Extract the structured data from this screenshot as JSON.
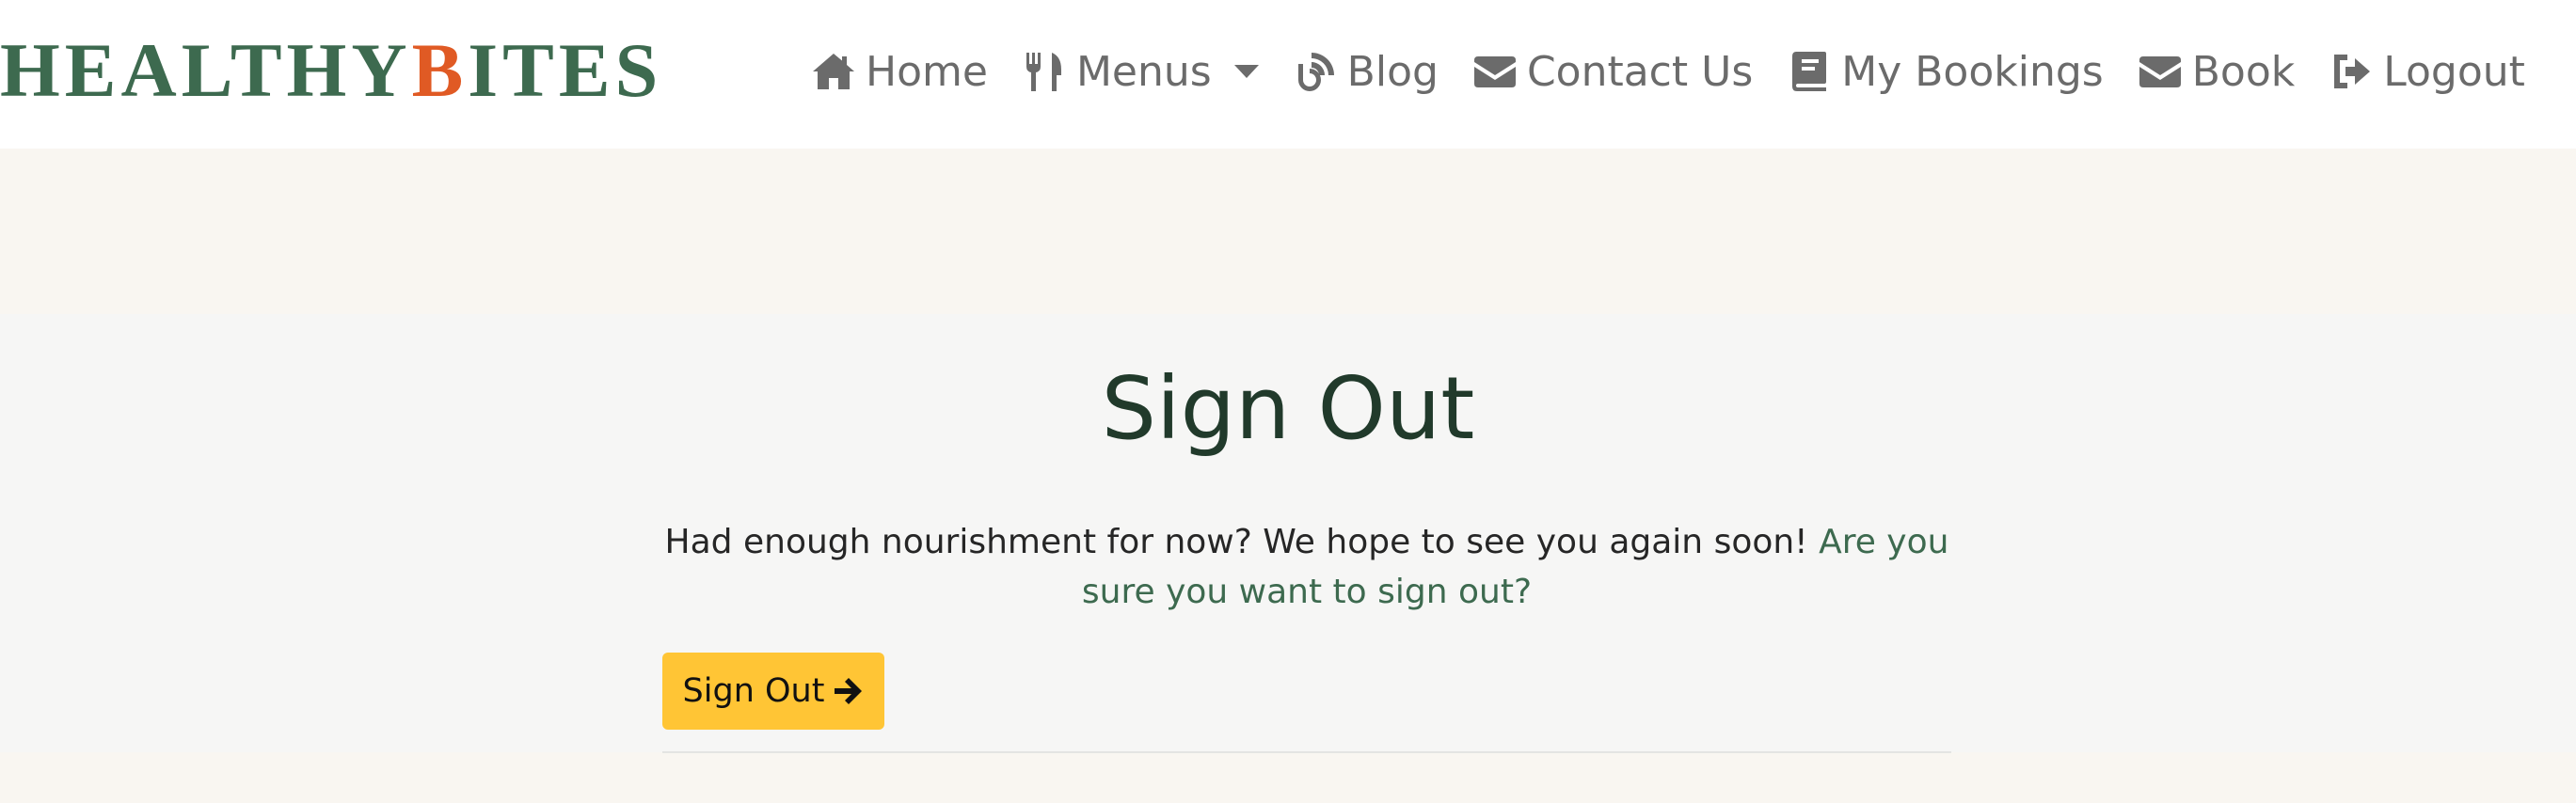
{
  "brand": {
    "part1": "HEALTHY",
    "part2": "B",
    "part3": "ITES",
    "color_primary": "#3d6a4f",
    "color_accent": "#e05a24"
  },
  "nav": {
    "home": {
      "label": "Home",
      "icon": "home-icon"
    },
    "menus": {
      "label": "Menus",
      "icon": "utensils-icon"
    },
    "blog": {
      "label": "Blog",
      "icon": "blog-icon"
    },
    "contact": {
      "label": "Contact Us",
      "icon": "envelope-icon"
    },
    "bookings": {
      "label": "My Bookings",
      "icon": "book-icon"
    },
    "book": {
      "label": "Book",
      "icon": "envelope-icon"
    },
    "logout": {
      "label": "Logout",
      "icon": "sign-out-icon"
    }
  },
  "main": {
    "title": "Sign Out",
    "message": "Had enough nourishment for now? We hope to see you again soon!",
    "confirm_text": "Are you sure you want to sign out?",
    "button_label": "Sign Out",
    "button_icon": "arrow-right-icon",
    "button_color": "#ffc535"
  }
}
